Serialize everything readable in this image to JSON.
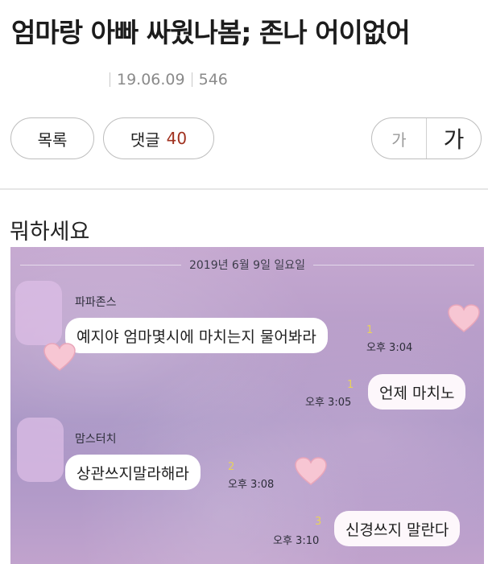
{
  "post": {
    "title": "엄마랑 아빠 싸웠나봄; 존나 어이없어",
    "date": "19.06.09",
    "views": "546",
    "body": "뭐하세요"
  },
  "toolbar": {
    "list_label": "목록",
    "comment_label": "댓글",
    "comment_count": "40",
    "font_small": "가",
    "font_large": "가"
  },
  "chat": {
    "date": "2019년 6월 9일 일요일",
    "messages": [
      {
        "sender": "파파존스",
        "text": "예지야 엄마몇시에 마치는지 물어봐라",
        "read": "1",
        "time": "오후 3:04"
      },
      {
        "sender": "",
        "text": "언제 마치노",
        "read": "1",
        "time": "오후 3:05"
      },
      {
        "sender": "맘스터치",
        "text": "상관쓰지말라해라",
        "read": "2",
        "time": "오후 3:08"
      },
      {
        "sender": "",
        "text": "신경쓰지 말란다",
        "read": "3",
        "time": "오후 3:10"
      }
    ]
  },
  "colors": {
    "comment_count": "#a0311f",
    "heart": "#f7c6d3",
    "unread": "#e8d25a"
  },
  "icons": [
    "heart-icon"
  ]
}
